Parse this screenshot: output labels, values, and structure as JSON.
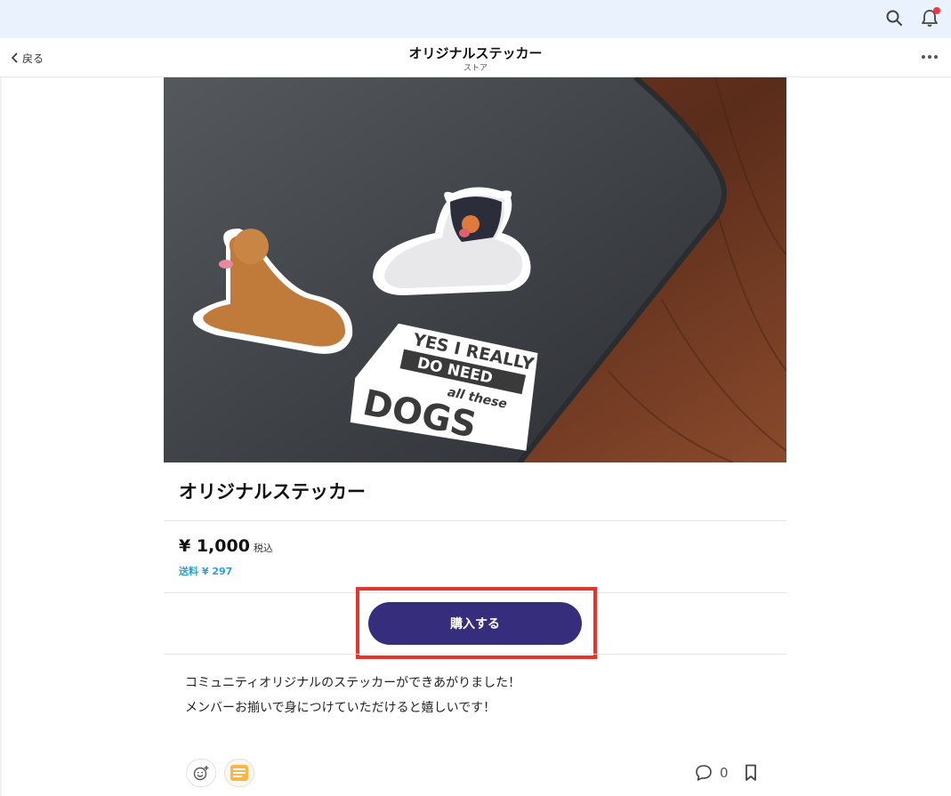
{
  "header": {
    "back_label": "戻る",
    "title": "オリジナルステッカー",
    "subtitle": "ストア",
    "icons": [
      "search-icon",
      "bell-icon",
      "more-icon"
    ],
    "notification_dot_color": "#f2373b"
  },
  "product": {
    "image_text": {
      "line1": "YES I REALLY",
      "line2": "DO NEED",
      "line3": "all these",
      "line4": "DOGS"
    },
    "title": "オリジナルステッカー",
    "price": "¥ 1,000",
    "tax_label": "税込",
    "shipping": "送料 ¥ 297",
    "buy_label": "購入する",
    "buy_color": "#372d7d",
    "description_lines": [
      "コミュニティオリジナルのステッカーができあがりました！",
      "メンバーお揃いで身につけていただけると嬉しいです！"
    ]
  },
  "footer": {
    "comment_count": "0",
    "icons": [
      "add-reaction-icon",
      "sticker-reaction-icon",
      "comment-icon",
      "bookmark-icon"
    ]
  }
}
